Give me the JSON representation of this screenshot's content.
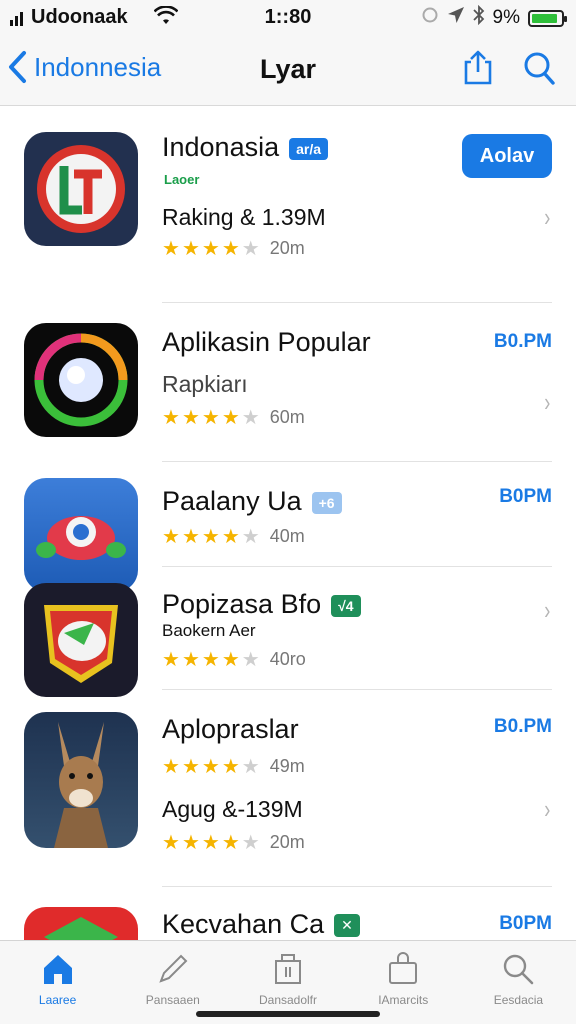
{
  "status_bar": {
    "carrier": "Udoonaak",
    "time": "1::80",
    "battery": "9%",
    "battery_level": 0.9,
    "icons": [
      "signal-bars-icon",
      "wifi-icon",
      "alarm-icon",
      "location-arrow-icon",
      "bluetooth-icon",
      "battery-icon"
    ]
  },
  "nav": {
    "back_label": "Indonnesia",
    "title": "Lyar",
    "icons": [
      "chevron-left-icon",
      "share-icon",
      "search-icon"
    ]
  },
  "colors": {
    "accent": "#1a7ae4",
    "star": "#f5b400",
    "badge_blue": "#1a7ae4",
    "badge_lightblue": "#9cc4f0",
    "badge_green": "#1f8f5a"
  },
  "apps": [
    {
      "name": "Indonasia",
      "badge": "ar/a",
      "tag": "Laoer",
      "subtitle": "Raking & 1.39M",
      "rating": 4,
      "rating_count": "20m",
      "action": "Aolav"
    },
    {
      "name": "Aplikasin Popular",
      "subtitle": "Rapkiarı",
      "rating": 4,
      "rating_count": "60m",
      "price": "B0.PM"
    },
    {
      "name": "Paalany Ua",
      "badge": "+6",
      "rating": 4,
      "rating_count": "40m",
      "price": "B0PM"
    },
    {
      "name": "Popizasa Bfo",
      "badge": "√4",
      "subtitle": "Baokern Aer",
      "rating": 4,
      "rating_count": "40ro"
    },
    {
      "name": "Aplopraslar",
      "rating": 4,
      "rating_count": "49m",
      "subtitle2": "Agug &-139M",
      "rating2": 4,
      "rating_count2": "20m",
      "price": "B0.PM"
    },
    {
      "name": "Kecvahan Ca",
      "badge": "✕",
      "price": "B0PM"
    }
  ],
  "tabs": [
    {
      "label": "Laaree",
      "icon": "home-icon",
      "active": true
    },
    {
      "label": "Pansaaen",
      "icon": "pen-icon",
      "active": false
    },
    {
      "label": "Dansadolfr",
      "icon": "archive-box-icon",
      "active": false
    },
    {
      "label": "IAmarcits",
      "icon": "shopping-bag-icon",
      "active": false
    },
    {
      "label": "Eesdacia",
      "icon": "search-icon",
      "active": false
    }
  ]
}
